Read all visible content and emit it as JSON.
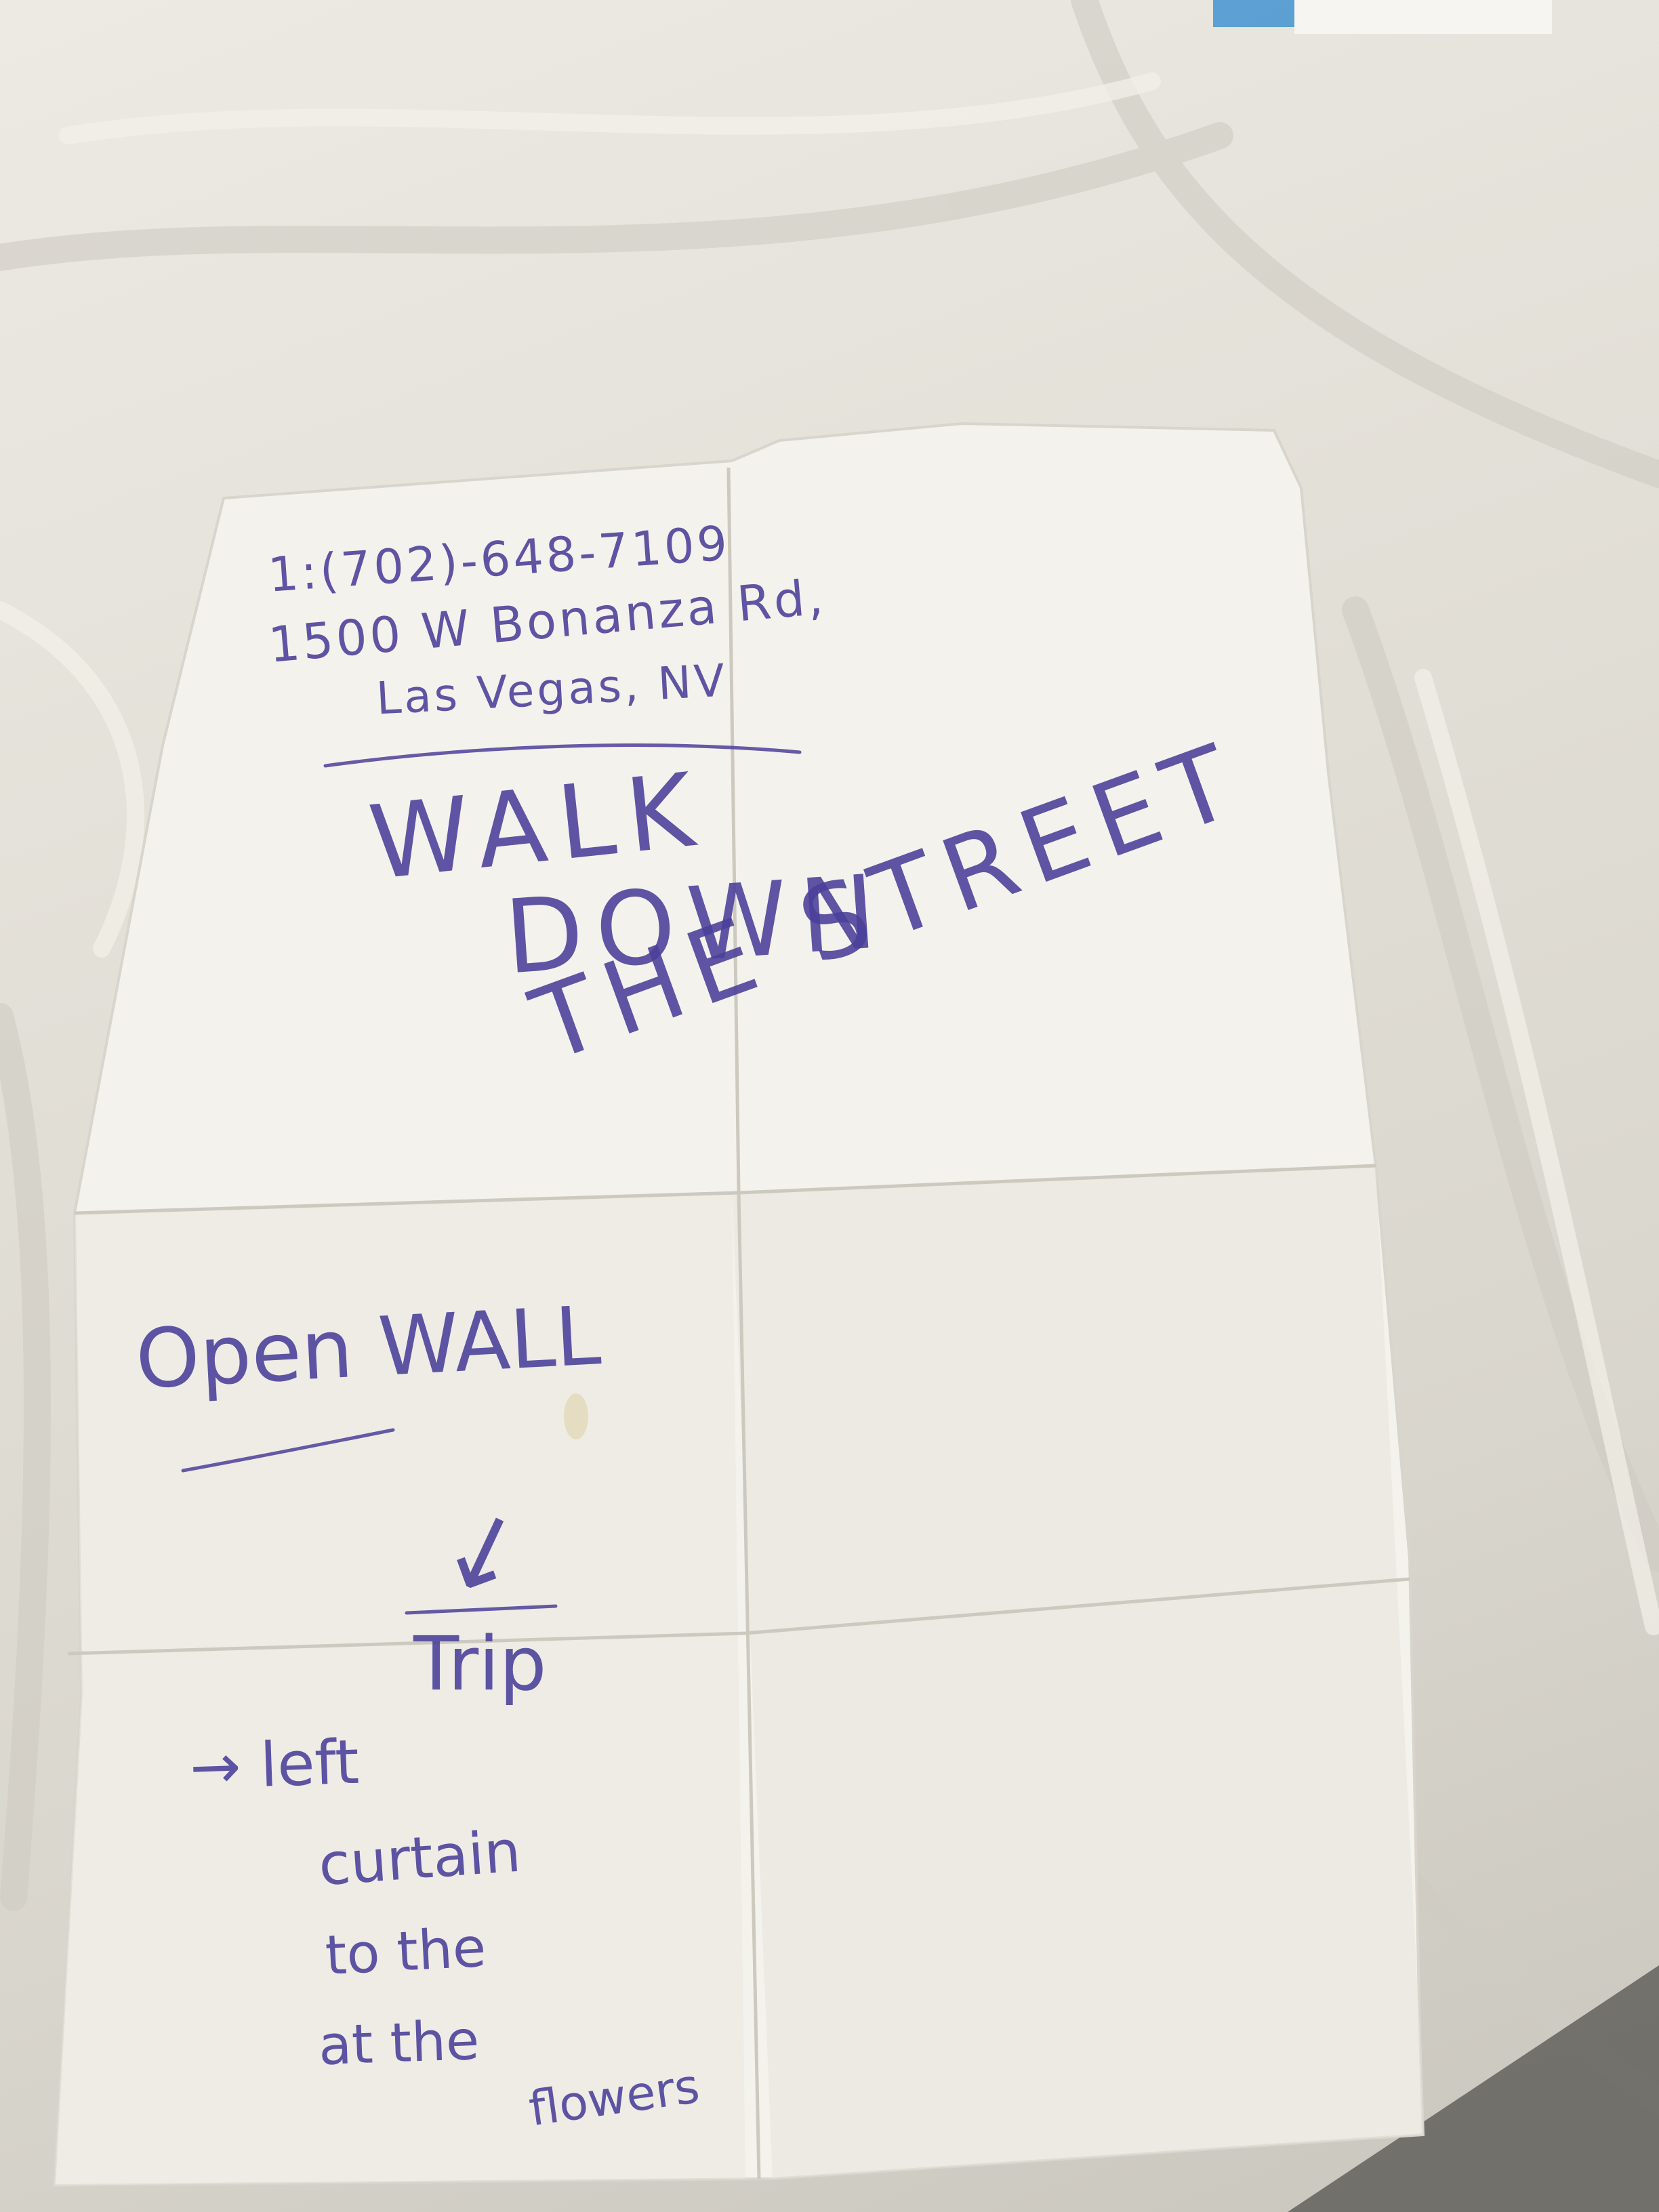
{
  "note": {
    "phone": "1:(702)-648-7109",
    "street": "1500 W Bonanza Rd,",
    "city": "Las Vegas, NV",
    "headline_line1": "WALK",
    "headline_line2": "DOWN",
    "headline_line3": "THE STREET",
    "open_wall": "Open WALL",
    "arrow": "↓",
    "item_1": "Trip",
    "item_2": "→ left",
    "item_3": "curtain",
    "item_4": "to the",
    "item_5": "at the",
    "item_6": "flowers"
  },
  "colors": {
    "ink": "#4a3f9a",
    "paper": "#f4f2ec",
    "sheet_background": "#e3e0d8"
  }
}
